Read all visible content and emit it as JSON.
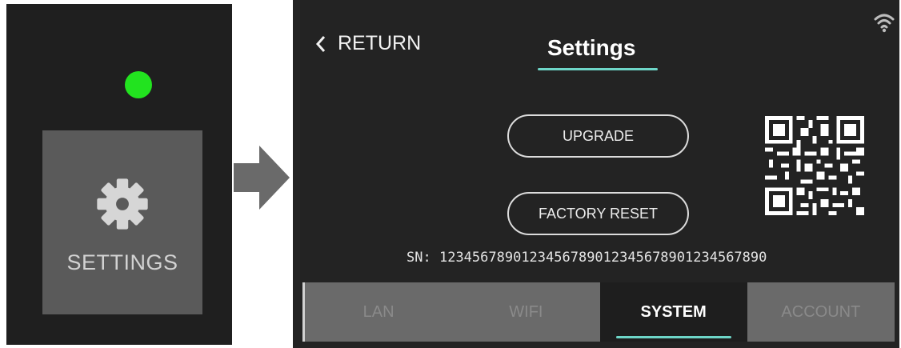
{
  "device": {
    "settings_label": "SETTINGS",
    "status_color": "#22e31f",
    "settings_icon": "gear-icon"
  },
  "screen": {
    "return_label": "RETURN",
    "title": "Settings",
    "upgrade_label": "UPGRADE",
    "factory_reset_label": "FACTORY RESET",
    "sn_label": "SN:",
    "sn_value": "1234567890123456789012345678901234567890"
  },
  "tabs": [
    {
      "label": "LAN",
      "active": false
    },
    {
      "label": "WIFI",
      "active": false
    },
    {
      "label": "SYSTEM",
      "active": true
    },
    {
      "label": "ACCOUNT",
      "active": false
    }
  ],
  "colors": {
    "accent": "#6ed6c8",
    "screen_bg": "#232323",
    "tile_bg": "#5a5a5a"
  }
}
